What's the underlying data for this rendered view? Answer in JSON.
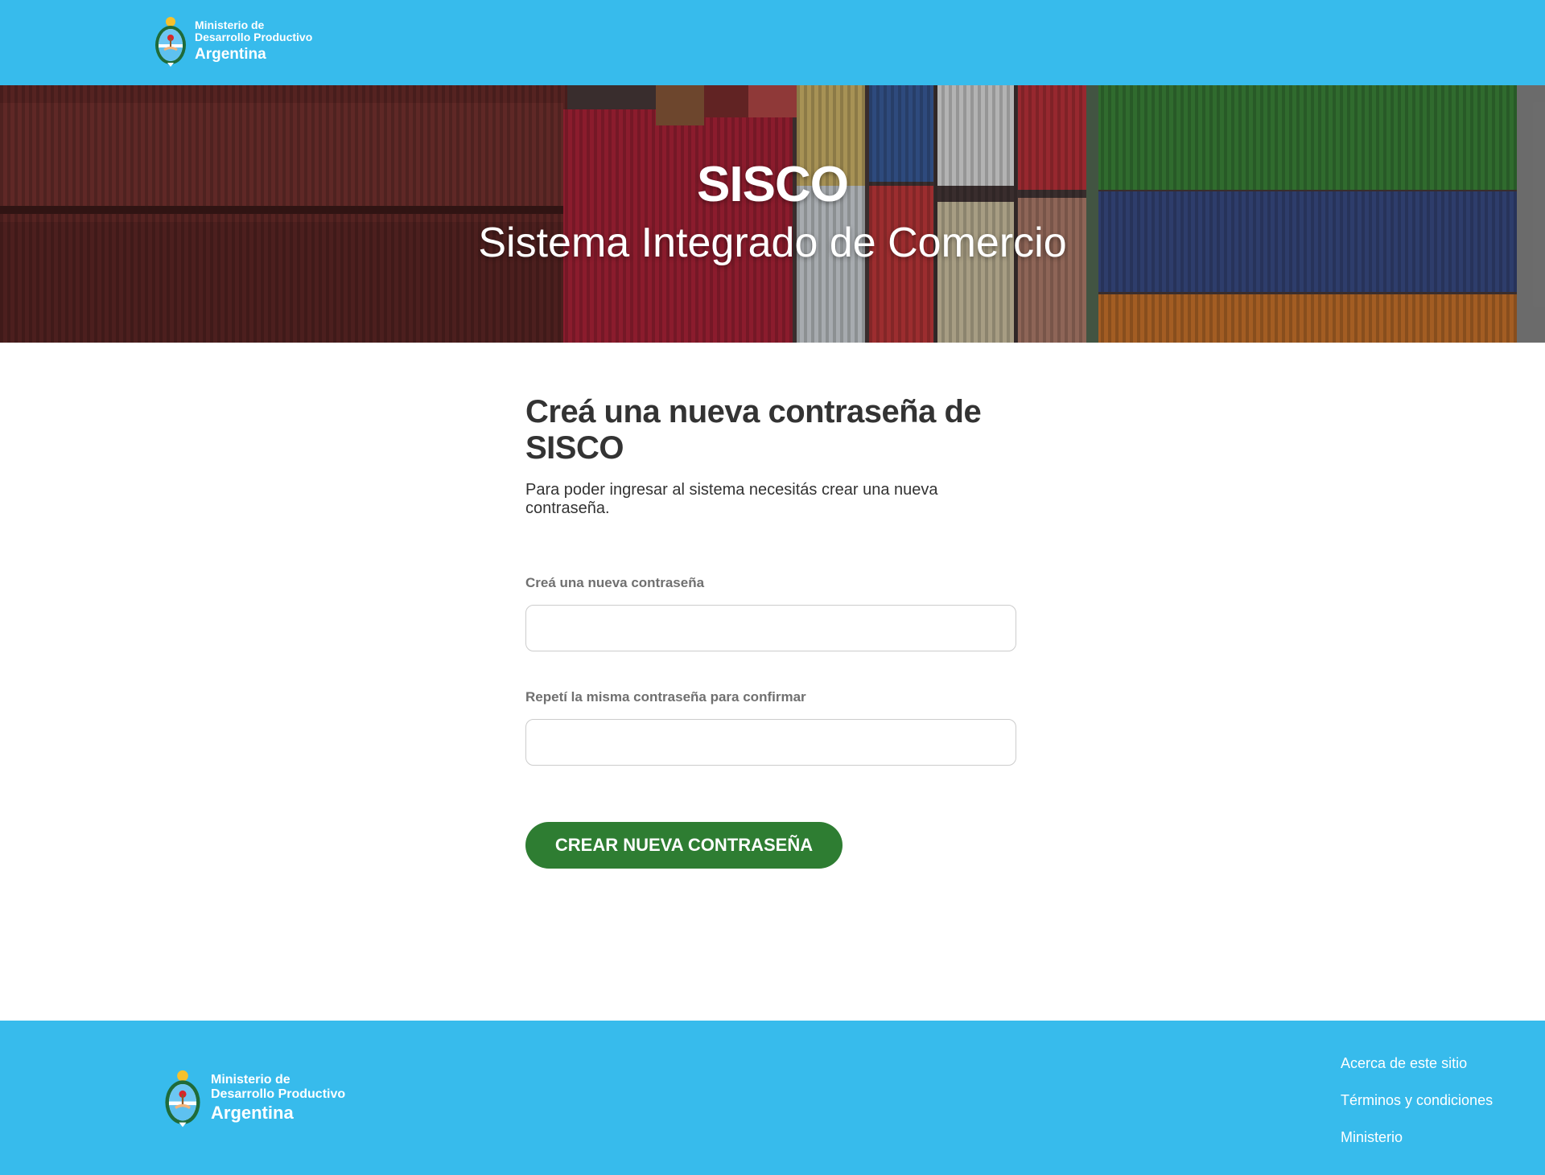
{
  "header": {
    "logo": {
      "line1": "Ministerio de",
      "line2": "Desarrollo Productivo",
      "line3": "Argentina",
      "icon": "coat-of-arms-icon"
    }
  },
  "hero": {
    "title": "SISCO",
    "subtitle": "Sistema Integrado de Comercio"
  },
  "form": {
    "title": "Creá una nueva contraseña de SISCO",
    "description": "Para poder ingresar al sistema necesitás crear una nueva contraseña.",
    "password_label": "Creá una nueva contraseña",
    "password_value": "",
    "confirm_label": "Repetí la misma contraseña para confirmar",
    "confirm_value": "",
    "submit_label": "CREAR NUEVA CONTRASEÑA"
  },
  "footer": {
    "logo": {
      "line1": "Ministerio de",
      "line2": "Desarrollo Productivo",
      "line3": "Argentina",
      "icon": "coat-of-arms-icon"
    },
    "links": [
      "Acerca de este sitio",
      "Términos y condiciones",
      "Ministerio"
    ]
  },
  "colors": {
    "brand_blue": "#37bbec",
    "button_green": "#2e7d32",
    "text_dark": "#333333",
    "label_gray": "#707070"
  }
}
